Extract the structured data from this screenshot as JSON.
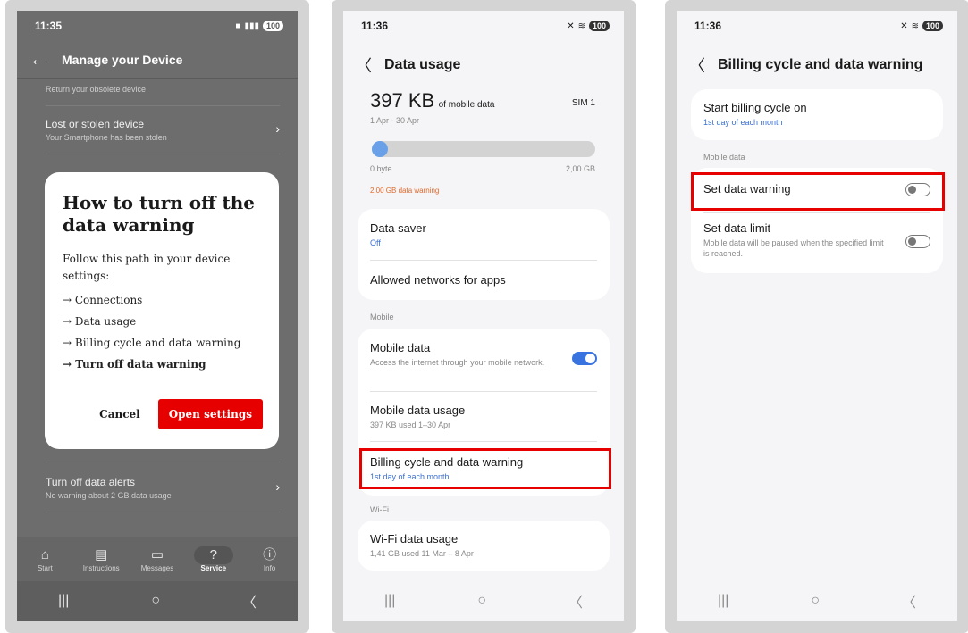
{
  "screen1": {
    "status": {
      "time": "11:35",
      "battery": "100"
    },
    "header": {
      "back_icon": "←",
      "title": "Manage your Device"
    },
    "items": [
      {
        "title": "",
        "desc": "Return your obsolete device"
      },
      {
        "title": "Lost or stolen device",
        "desc": "Your Smartphone has been stolen"
      },
      {
        "title": "Turn off data alerts",
        "desc": "No warning about 2 GB data usage"
      }
    ],
    "dialog": {
      "title": "How to turn off the data warning",
      "intro": "Follow this path in your device settings:",
      "steps": [
        "→ Connections",
        "→ Data usage",
        "→ Billing cycle and data warning",
        "→ Turn off data warning"
      ],
      "cancel_label": "Cancel",
      "open_label": "Open settings"
    },
    "tabs": [
      {
        "label": "Start",
        "icon": "⌂"
      },
      {
        "label": "Instructions",
        "icon": "▤"
      },
      {
        "label": "Messages",
        "icon": "▭"
      },
      {
        "label": "Service",
        "icon": "?"
      },
      {
        "label": "Info",
        "icon": "ⓘ"
      }
    ]
  },
  "screen2": {
    "status": {
      "time": "11:36",
      "battery": "100"
    },
    "header": {
      "back_icon": "〈",
      "title": "Data usage"
    },
    "usage": {
      "amount": "397 KB",
      "unit_label": "of mobile data",
      "sim": "SIM 1",
      "period": "1 Apr - 30 Apr",
      "min": "0 byte",
      "max": "2,00 GB",
      "warning": "2,00 GB data warning",
      "fill_fraction": 0.0002
    },
    "card1": {
      "data_saver": {
        "title": "Data saver",
        "value": "Off"
      },
      "allowed": {
        "title": "Allowed networks for apps"
      }
    },
    "section_mobile": "Mobile",
    "card2": {
      "mobile_data": {
        "title": "Mobile data",
        "desc": "Access the internet through your mobile network."
      },
      "mobile_usage": {
        "title": "Mobile data usage",
        "desc": "397 KB used 1–30 Apr"
      },
      "billing": {
        "title": "Billing cycle and data warning",
        "desc": "1st day of each month"
      }
    },
    "section_wifi": "Wi-Fi",
    "card3": {
      "wifi_usage": {
        "title": "Wi-Fi data usage",
        "desc": "1,41 GB used 11 Mar – 8 Apr"
      }
    }
  },
  "screen3": {
    "status": {
      "time": "11:36",
      "battery": "100"
    },
    "header": {
      "back_icon": "〈",
      "title": "Billing cycle and data warning"
    },
    "start_cycle": {
      "title": "Start billing cycle on",
      "desc": "1st day of each month"
    },
    "section_mobile": "Mobile data",
    "set_warning": {
      "title": "Set data warning"
    },
    "set_limit": {
      "title": "Set data limit",
      "desc": "Mobile data will be paused when the specified limit is reached."
    }
  },
  "nav": {
    "recent": "|||",
    "home": "○",
    "back": "〈"
  },
  "colors": {
    "accent_red": "#e60000",
    "toggle_blue": "#3873e0",
    "link_blue": "#3c6fd1",
    "warning_orange": "#e06a2c"
  }
}
